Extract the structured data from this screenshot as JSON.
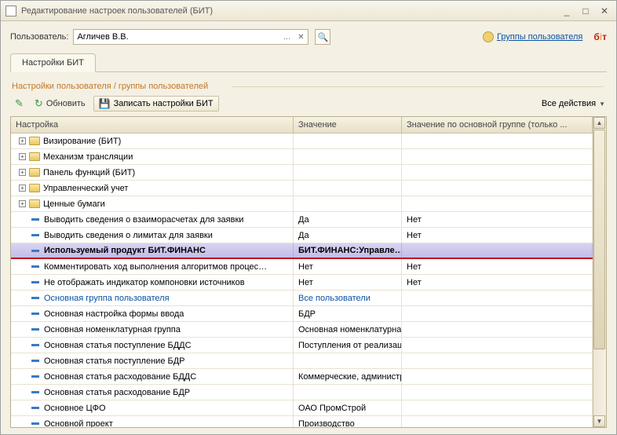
{
  "window": {
    "title": "Редактирование настроек пользователей (БИТ)"
  },
  "user": {
    "label": "Пользователь:",
    "value": "Агличев В.В."
  },
  "groups_link": "Группы пользователя",
  "tab_label": "Настройки БИТ",
  "subtitle": "Настройки пользователя / группы пользователей",
  "toolbar": {
    "refresh": "Обновить",
    "save": "Записать настройки БИТ",
    "all_actions": "Все действия"
  },
  "headers": {
    "name": "Настройка",
    "value": "Значение",
    "group_value": "Значение по основной группе (только ..."
  },
  "rows": [
    {
      "type": "folder",
      "label": "Визирование (БИТ)",
      "v": "",
      "g": ""
    },
    {
      "type": "folder",
      "label": "Механизм трансляции",
      "v": "",
      "g": ""
    },
    {
      "type": "folder",
      "label": "Панель функций (БИТ)",
      "v": "",
      "g": ""
    },
    {
      "type": "folder",
      "label": "Управленческий учет",
      "v": "",
      "g": ""
    },
    {
      "type": "folder",
      "label": "Ценные бумаги",
      "v": "",
      "g": ""
    },
    {
      "type": "leaf",
      "label": "Выводить сведения о взаиморасчетах для заявки",
      "v": "Да",
      "g": "Нет"
    },
    {
      "type": "leaf",
      "label": "Выводить сведения о лимитах для заявки",
      "v": "Да",
      "g": "Нет"
    },
    {
      "type": "leaf",
      "label": "Используемый продукт БИТ.ФИНАНС",
      "v": "БИТ.ФИНАНС:Управле…",
      "g": "",
      "selected": true,
      "underline": true,
      "bold": true
    },
    {
      "type": "leaf",
      "label": "Комментировать ход выполнения алгоритмов процес…",
      "v": "Нет",
      "g": "Нет"
    },
    {
      "type": "leaf",
      "label": "Не отображать индикатор компоновки источников",
      "v": "Нет",
      "g": "Нет"
    },
    {
      "type": "leaf",
      "label": "Основная группа пользователя",
      "v": "Все пользователи",
      "g": "",
      "link": true
    },
    {
      "type": "leaf",
      "label": "Основная настройка формы ввода",
      "v": "БДР",
      "g": ""
    },
    {
      "type": "leaf",
      "label": "Основная номенклатурная группа",
      "v": "Основная номенклатурная …",
      "g": ""
    },
    {
      "type": "leaf",
      "label": "Основная статья поступление БДДС",
      "v": "Поступления от реализаци…",
      "g": ""
    },
    {
      "type": "leaf",
      "label": "Основная статья поступление БДР",
      "v": "",
      "g": ""
    },
    {
      "type": "leaf",
      "label": "Основная статья расходование БДДС",
      "v": "Коммерческие, администра…",
      "g": ""
    },
    {
      "type": "leaf",
      "label": "Основная статья расходование БДР",
      "v": "",
      "g": ""
    },
    {
      "type": "leaf",
      "label": "Основное ЦФО",
      "v": "ОАО ПромСтрой",
      "g": ""
    },
    {
      "type": "leaf",
      "label": "Основной проект",
      "v": "Производство",
      "g": ""
    }
  ]
}
